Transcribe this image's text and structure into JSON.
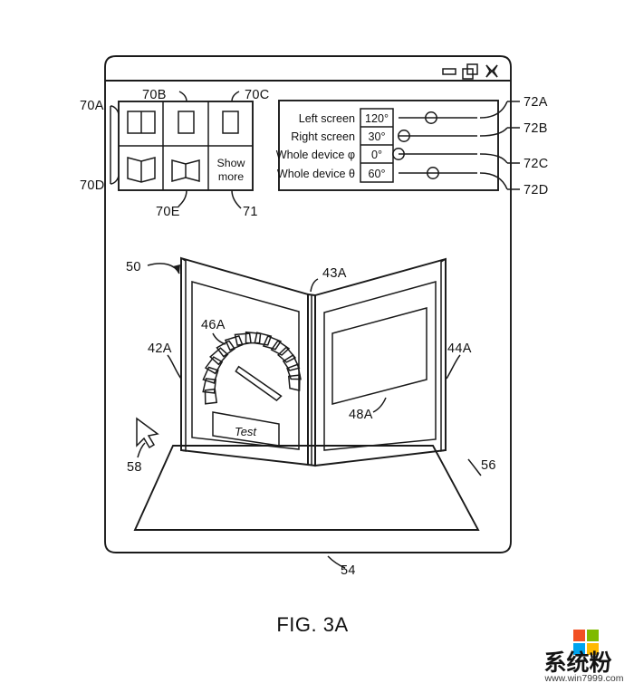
{
  "figure": {
    "caption": "FIG. 3A",
    "title_bar": {
      "buttons": [
        {
          "name": "minimize",
          "glyph": "minimize-icon"
        },
        {
          "name": "restore",
          "glyph": "restore-icon"
        },
        {
          "name": "close",
          "glyph": "close-icon"
        }
      ]
    },
    "thumbnail_panel": {
      "cells": [
        {
          "id": "70A",
          "type": "flat-dual-screen",
          "label": ""
        },
        {
          "id": "70B",
          "type": "single-screen",
          "label": ""
        },
        {
          "id": "70C",
          "type": "single-screen",
          "label": ""
        },
        {
          "id": "70D",
          "type": "folded-outward",
          "label": ""
        },
        {
          "id": "70E",
          "type": "folded-inward",
          "label": ""
        },
        {
          "id": "71",
          "type": "text",
          "label": "Show more",
          "label_line1": "Show",
          "label_line2": "more"
        }
      ]
    },
    "control_panel": {
      "rows": [
        {
          "id": "72A",
          "label": "Left screen",
          "value": "120°",
          "slider_pos": 0.42
        },
        {
          "id": "72B",
          "label": "Right screen",
          "value": "30°",
          "slider_pos": 0.1
        },
        {
          "id": "72C",
          "label": "Whole device φ",
          "value": "0°",
          "slider_pos": 0.0
        },
        {
          "id": "72D",
          "label": "Whole device θ",
          "value": "60°",
          "slider_pos": 0.44
        }
      ]
    },
    "device_preview": {
      "device_ref": "50",
      "left_screen_ref": "42A",
      "hinge_ref": "43A",
      "right_screen_ref": "44A",
      "gauge_ref": "46A",
      "video_ref": "48A",
      "base_ref": "56",
      "cursor_ref": "58",
      "window_ref": "54",
      "button_label": "Test",
      "gauge_segments": 16
    }
  },
  "watermark": {
    "brand_cn": "系统粉",
    "url": "www.win7999.com",
    "logo_colors": {
      "top_left": "#f25022",
      "top_right": "#7fba00",
      "bottom_left": "#00a4ef",
      "bottom_right": "#ffb900"
    }
  }
}
